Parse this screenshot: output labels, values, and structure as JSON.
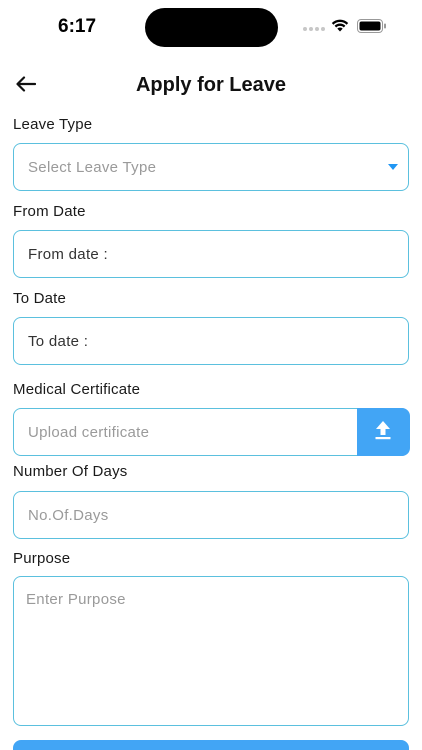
{
  "status_bar": {
    "time": "6:17"
  },
  "header": {
    "title": "Apply for Leave"
  },
  "form": {
    "leave_type": {
      "label": "Leave Type",
      "placeholder": "Select Leave Type"
    },
    "from_date": {
      "label": "From Date",
      "value": "From date :"
    },
    "to_date": {
      "label": "To Date",
      "value": "To date :"
    },
    "medical_certificate": {
      "label": "Medical Certificate",
      "placeholder": "Upload certificate"
    },
    "number_of_days": {
      "label": "Number Of Days",
      "placeholder": "No.Of.Days"
    },
    "purpose": {
      "label": "Purpose",
      "placeholder": "Enter Purpose"
    }
  },
  "icons": {
    "back": "arrow-left-icon",
    "dropdown": "caret-down-icon",
    "upload": "upload-icon",
    "wifi": "wifi-icon",
    "battery": "battery-icon",
    "signal": "cellular-signal-icon"
  },
  "colors": {
    "accent": "#42a5f5",
    "border": "#5bc0de",
    "caret": "#2196f3"
  }
}
